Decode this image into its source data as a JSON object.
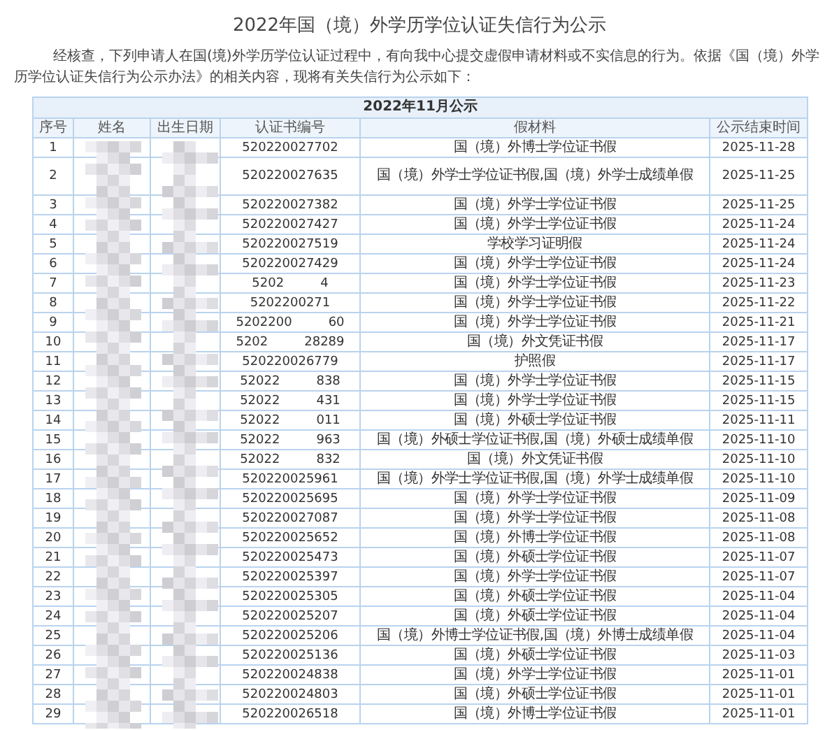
{
  "page": {
    "title": "2022年国（境）外学历学位认证失信行为公示",
    "intro": "经核查，下列申请人在国(境)外学历学位认证过程中，有向我中心提交虚假申请材料或不实信息的行为。依据《国（境）外学历学位认证失信行为公示办法》的相关内容，现将有关失信行为公示如下："
  },
  "table": {
    "caption": "2022年11月公示",
    "columns": [
      "序号",
      "姓名",
      "出生日期",
      "认证书编号",
      "假材料",
      "公示结束时间"
    ],
    "rows": [
      {
        "no": "1",
        "cert": [
          "520220027702"
        ],
        "material": "国（境）外博士学位证书假",
        "end": "2025-11-28"
      },
      {
        "no": "2",
        "cert": [
          "520220027635"
        ],
        "material": "国（境）外学士学位证书假,国（境）外学士成绩单假",
        "end": "2025-11-25"
      },
      {
        "no": "3",
        "cert": [
          "520220027382"
        ],
        "material": "国（境）外学士学位证书假",
        "end": "2025-11-25"
      },
      {
        "no": "4",
        "cert": [
          "520220027427"
        ],
        "material": "国（境）外学士学位证书假",
        "end": "2025-11-24"
      },
      {
        "no": "5",
        "cert": [
          "520220027519"
        ],
        "material": "学校学习证明假",
        "end": "2025-11-24"
      },
      {
        "no": "6",
        "cert": [
          "520220027429"
        ],
        "material": "国（境）外学士学位证书假",
        "end": "2025-11-24"
      },
      {
        "no": "7",
        "cert": [
          "5202",
          "4"
        ],
        "material": "国（境）外学士学位证书假",
        "end": "2025-11-23"
      },
      {
        "no": "8",
        "cert": [
          "5202200271"
        ],
        "material": "国（境）外学士学位证书假",
        "end": "2025-11-22"
      },
      {
        "no": "9",
        "cert": [
          "5202200",
          "60"
        ],
        "material": "国（境）外学士学位证书假",
        "end": "2025-11-21"
      },
      {
        "no": "10",
        "cert": [
          "5202",
          "28289"
        ],
        "material": "国（境）外文凭证书假",
        "end": "2025-11-17"
      },
      {
        "no": "11",
        "cert": [
          "520220026779"
        ],
        "material": "护照假",
        "end": "2025-11-17"
      },
      {
        "no": "12",
        "cert": [
          "52022",
          "838"
        ],
        "material": "国（境）外学士学位证书假",
        "end": "2025-11-15"
      },
      {
        "no": "13",
        "cert": [
          "52022",
          "431"
        ],
        "material": "国（境）外学士学位证书假",
        "end": "2025-11-15"
      },
      {
        "no": "14",
        "cert": [
          "52022",
          "011"
        ],
        "material": "国（境）外硕士学位证书假",
        "end": "2025-11-11"
      },
      {
        "no": "15",
        "cert": [
          "52022",
          "963"
        ],
        "material": "国（境）外硕士学位证书假,国（境）外硕士成绩单假",
        "end": "2025-11-10"
      },
      {
        "no": "16",
        "cert": [
          "52022",
          "832"
        ],
        "material": "国（境）外文凭证书假",
        "end": "2025-11-10"
      },
      {
        "no": "17",
        "cert": [
          "520220025961"
        ],
        "material": "国（境）外学士学位证书假,国（境）外学士成绩单假",
        "end": "2025-11-10"
      },
      {
        "no": "18",
        "cert": [
          "520220025695"
        ],
        "material": "国（境）外学士学位证书假",
        "end": "2025-11-09"
      },
      {
        "no": "19",
        "cert": [
          "520220027087"
        ],
        "material": "国（境）外学士学位证书假",
        "end": "2025-11-08"
      },
      {
        "no": "20",
        "cert": [
          "520220025652"
        ],
        "material": "国（境）外博士学位证书假",
        "end": "2025-11-08"
      },
      {
        "no": "21",
        "cert": [
          "520220025473"
        ],
        "material": "国（境）外硕士学位证书假",
        "end": "2025-11-07"
      },
      {
        "no": "22",
        "cert": [
          "520220025397"
        ],
        "material": "国（境）外学士学位证书假",
        "end": "2025-11-07"
      },
      {
        "no": "23",
        "cert": [
          "520220025305"
        ],
        "material": "国（境）外硕士学位证书假",
        "end": "2025-11-04"
      },
      {
        "no": "24",
        "cert": [
          "520220025207"
        ],
        "material": "国（境）外硕士学位证书假",
        "end": "2025-11-04"
      },
      {
        "no": "25",
        "cert": [
          "520220025206"
        ],
        "material": "国（境）外博士学位证书假,国（境）外博士成绩单假",
        "end": "2025-11-04"
      },
      {
        "no": "26",
        "cert": [
          "520220025136"
        ],
        "material": "国（境）外硕士学位证书假",
        "end": "2025-11-03"
      },
      {
        "no": "27",
        "cert": [
          "520220024838"
        ],
        "material": "国（境）外学士学位证书假",
        "end": "2025-11-01"
      },
      {
        "no": "28",
        "cert": [
          "520220024803"
        ],
        "material": "国（境）外硕士学位证书假",
        "end": "2025-11-01"
      },
      {
        "no": "29",
        "cert": [
          "520220026518"
        ],
        "material": "国（境）外博士学位证书假",
        "end": "2025-11-01"
      }
    ]
  }
}
